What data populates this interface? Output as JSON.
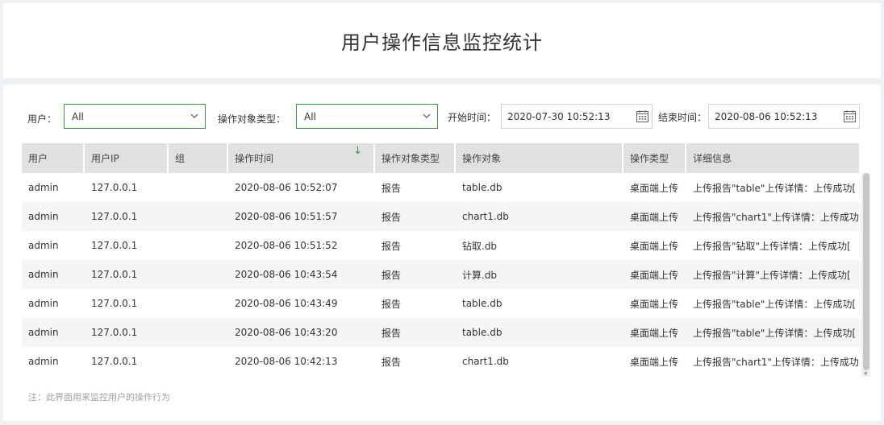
{
  "page": {
    "title": "用户操作信息监控统计"
  },
  "filters": {
    "user_label": "用户：",
    "user_value": "All",
    "type_label": "操作对象类型：",
    "type_value": "All",
    "start_label": "开始时间：",
    "start_value": "2020-07-30 10:52:13",
    "end_label": "结束时间：",
    "end_value": "2020-08-06 10:52:13"
  },
  "table": {
    "columns": [
      "用户",
      "用户IP",
      "组",
      "操作时间",
      "操作对象类型",
      "操作对象",
      "操作类型",
      "详细信息"
    ],
    "sort_icon": "↓",
    "rows": [
      [
        "admin",
        "127.0.0.1",
        "",
        "2020-08-06 10:52:07",
        "报告",
        "table.db",
        "桌面端上传",
        "上传报告\"table\"上传详情：上传成功["
      ],
      [
        "admin",
        "127.0.0.1",
        "",
        "2020-08-06 10:51:57",
        "报告",
        "chart1.db",
        "桌面端上传",
        "上传报告\"chart1\"上传详情：上传成功"
      ],
      [
        "admin",
        "127.0.0.1",
        "",
        "2020-08-06 10:51:52",
        "报告",
        "钻取.db",
        "桌面端上传",
        "上传报告\"钻取\"上传详情：上传成功["
      ],
      [
        "admin",
        "127.0.0.1",
        "",
        "2020-08-06 10:43:54",
        "报告",
        "计算.db",
        "桌面端上传",
        "上传报告\"计算\"上传详情：上传成功["
      ],
      [
        "admin",
        "127.0.0.1",
        "",
        "2020-08-06 10:43:49",
        "报告",
        "table.db",
        "桌面端上传",
        "上传报告\"table\"上传详情：上传成功["
      ],
      [
        "admin",
        "127.0.0.1",
        "",
        "2020-08-06 10:43:20",
        "报告",
        "table.db",
        "桌面端上传",
        "上传报告\"table\"上传详情：上传成功["
      ],
      [
        "admin",
        "127.0.0.1",
        "",
        "2020-08-06 10:42:13",
        "报告",
        "chart1.db",
        "桌面端上传",
        "上传报告\"chart1\"上传详情：上传成功"
      ]
    ]
  },
  "footer": {
    "note": "注：此界面用来监控用户的操作行为"
  },
  "colors": {
    "accent": "#2e9c48",
    "header_bg": "#e1e1e1",
    "row_alt": "#f5f5f5"
  }
}
